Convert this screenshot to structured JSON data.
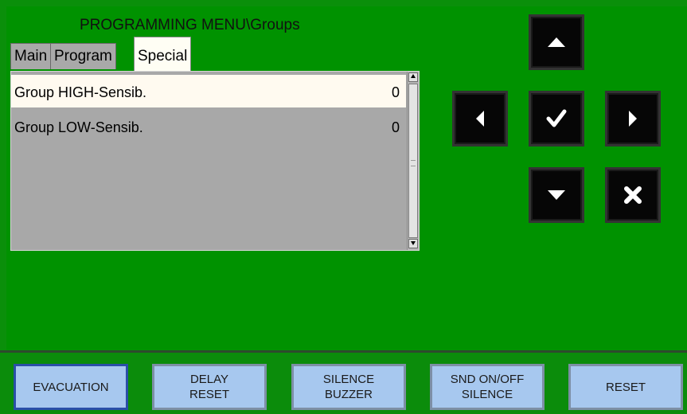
{
  "header": {
    "title": "PROGRAMMING MENU\\Groups"
  },
  "tabs": [
    {
      "label": "Main",
      "active": false
    },
    {
      "label": "Program",
      "active": false
    },
    {
      "label": "Special",
      "active": true
    }
  ],
  "list": {
    "rows": [
      {
        "name": "Group HIGH-Sensib.",
        "value": "0",
        "selected": true
      },
      {
        "name": "Group LOW-Sensib.",
        "value": "0",
        "selected": false
      }
    ]
  },
  "nav": {
    "up": "arrow-up-icon",
    "left": "arrow-left-icon",
    "ok": "checkmark-icon",
    "right": "arrow-right-icon",
    "down": "arrow-down-icon",
    "cancel": "cross-icon"
  },
  "bottom": {
    "evacuation": "EVACUATION",
    "delay_reset_l1": "DELAY",
    "delay_reset_l2": "RESET",
    "silence_buzzer_l1": "SILENCE",
    "silence_buzzer_l2": "BUZZER",
    "snd_silence_l1": "SND ON/OFF",
    "snd_silence_l2": "SILENCE",
    "reset": "RESET"
  },
  "colors": {
    "background": "#009200",
    "button_face": "#a7c8ef",
    "nav_button": "#060606",
    "list_background": "#a8a8a8",
    "selected_row": "#fffaf0"
  }
}
